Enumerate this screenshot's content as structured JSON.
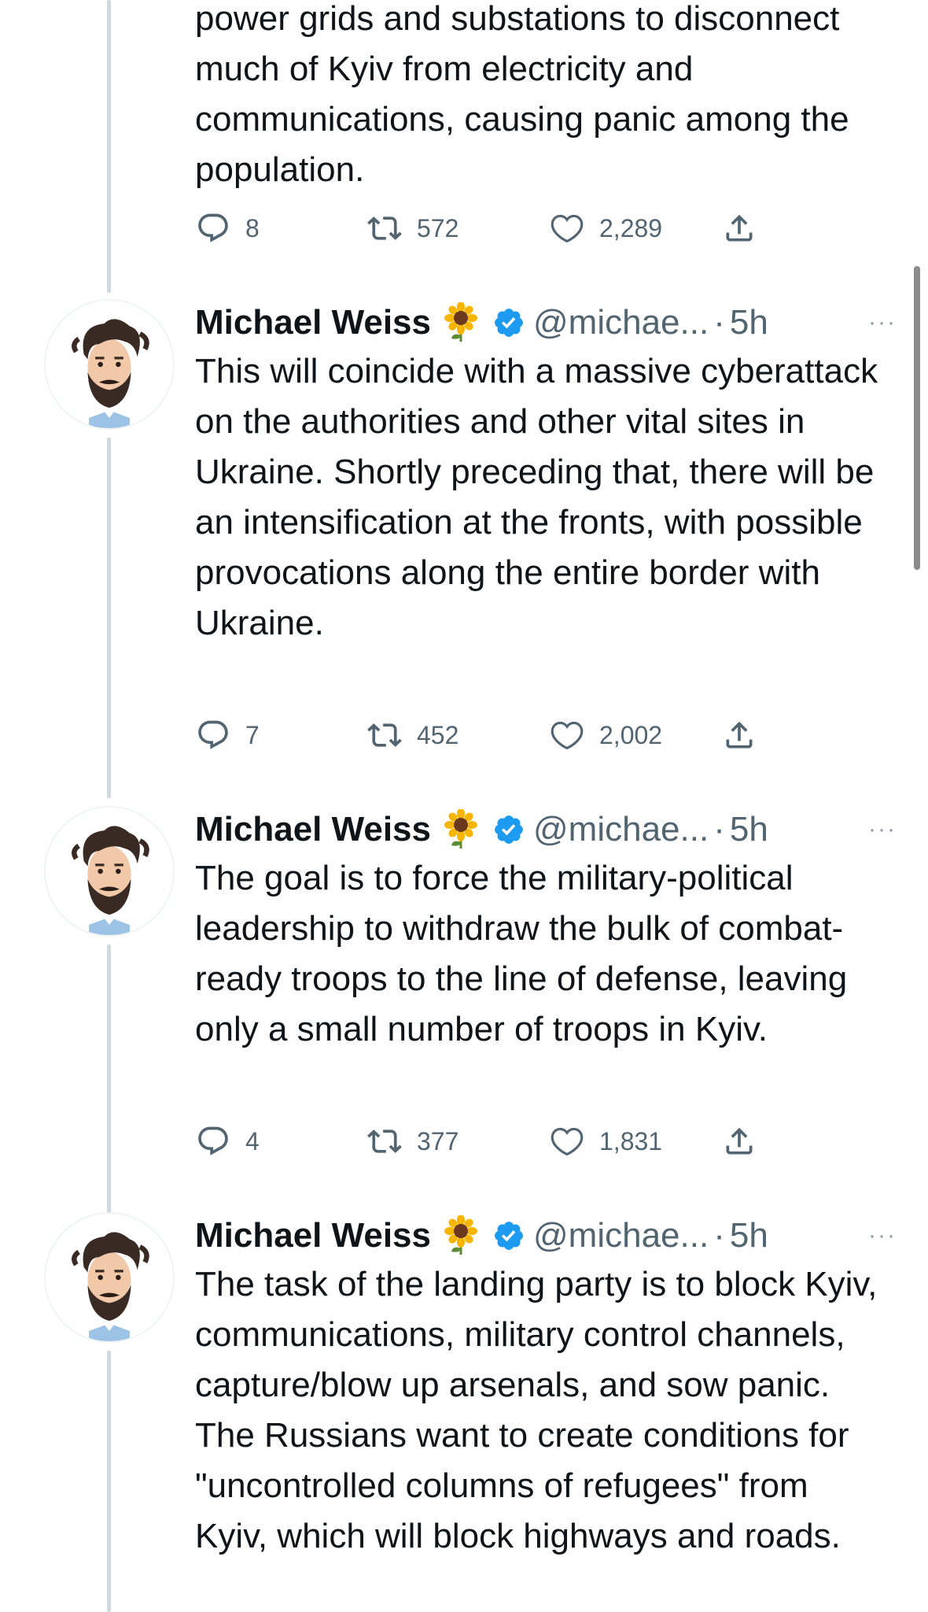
{
  "colors": {
    "text": "#0f1419",
    "secondary": "#536471",
    "verified": "#1d9bf0",
    "thread_line": "#cfd9de"
  },
  "prev_tweet": {
    "text": "power grids and substations to disconnect much of Kyiv from electricity and communications, causing panic among the population.",
    "replies": "8",
    "retweets": "572",
    "likes": "2,289"
  },
  "tweets": [
    {
      "name": "Michael Weiss",
      "emoji": "sunflower-icon",
      "handle": "@michae...",
      "dot": "·",
      "time": "5h",
      "text": "This will coincide with a massive cyberattack on the authorities and other vital sites in Ukraine. Shortly preceding that, there will be an intensification at the fronts, with possible provocations along the entire border with Ukraine.",
      "replies": "7",
      "retweets": "452",
      "likes": "2,002"
    },
    {
      "name": "Michael Weiss",
      "emoji": "sunflower-icon",
      "handle": "@michae...",
      "dot": "·",
      "time": "5h",
      "text": "The goal is to force the military-political leadership to withdraw the bulk of combat-ready troops to the line of defense, leaving only a small number of troops in Kyiv.",
      "replies": "4",
      "retweets": "377",
      "likes": "1,831"
    },
    {
      "name": "Michael Weiss",
      "emoji": "sunflower-icon",
      "handle": "@michae...",
      "dot": "·",
      "time": "5h",
      "text": "The task of the landing party is to block Kyiv, communications, military control channels, capture/blow up arsenals, and sow panic. The Russians want to create conditions for \"uncontrolled columns of refugees\" from Kyiv, which will block highways and roads."
    }
  ],
  "more_label": "···"
}
